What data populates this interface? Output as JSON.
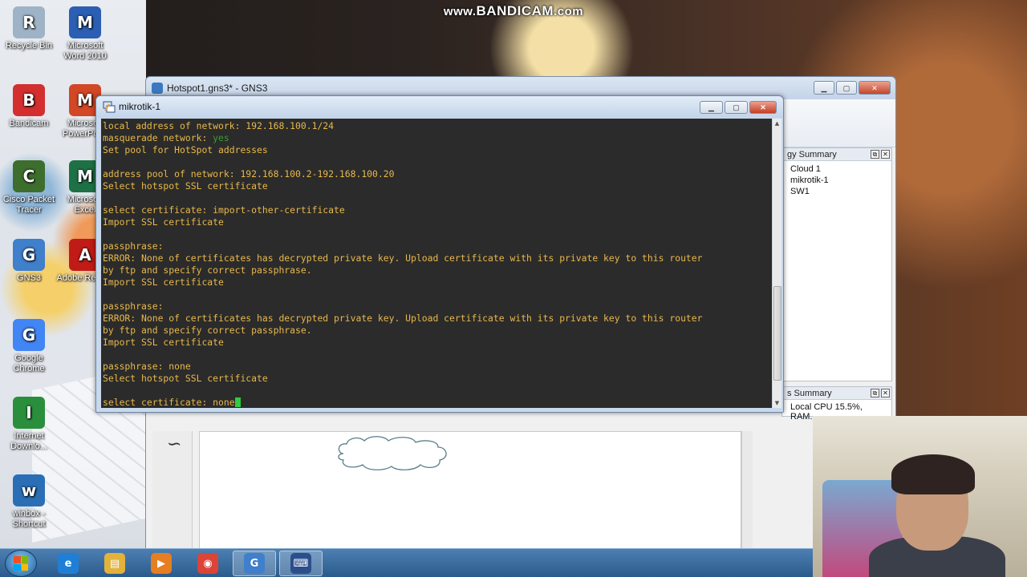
{
  "watermark": {
    "prefix": "www.",
    "brand": "BANDICAM",
    "suffix": ".com"
  },
  "desktop_icons": [
    {
      "label": "Recycle Bin",
      "icon": "recycle-bin-icon",
      "color": "#9fb3c6"
    },
    {
      "label": "Microsoft Word 2010",
      "icon": "word-icon",
      "color": "#2b5fb4"
    },
    {
      "label": "Bandicam",
      "icon": "bandicam-icon",
      "color": "#d32f2f"
    },
    {
      "label": "Microsoft PowerPoint",
      "icon": "powerpoint-icon",
      "color": "#d24726"
    },
    {
      "label": "Cisco Packet Tracer",
      "icon": "packet-tracer-icon",
      "color": "#3d6e2d"
    },
    {
      "label": "Microsoft Excel",
      "icon": "excel-icon",
      "color": "#1e7145"
    },
    {
      "label": "GNS3",
      "icon": "gns3-icon",
      "color": "#3f7fcb"
    },
    {
      "label": "Adobe Reader",
      "icon": "adobe-reader-icon",
      "color": "#c11b17"
    },
    {
      "label": "Google Chrome",
      "icon": "chrome-icon",
      "color": "#4285f4"
    },
    {
      "label": "Internet Downlo...",
      "icon": "internet-download-manager-icon",
      "color": "#2a8f3c"
    },
    {
      "label": "winbox - Shortcut",
      "icon": "winbox-icon",
      "color": "#2a6fb5"
    }
  ],
  "gns3": {
    "title": "Hotspot1.gns3* - GNS3",
    "topology_summary": {
      "title": "gy Summary",
      "items": [
        "Cloud 1",
        "mikrotik-1",
        "SW1"
      ]
    },
    "servers_summary": {
      "title": "s Summary",
      "status": "Local CPU 15.5%, RAM..."
    }
  },
  "terminal": {
    "title": "mikrotik-1",
    "lines": [
      "local address of network: 192.168.100.1/24",
      "masquerade network: ",
      "Set pool for HotSpot addresses",
      "",
      "address pool of network: 192.168.100.2-192.168.100.20",
      "Select hotspot SSL certificate",
      "",
      "select certificate: import-other-certificate",
      "Import SSL certificate",
      "",
      "passphrase:",
      "ERROR: None of certificates has decrypted private key. Upload certificate with its private key to this router",
      "by ftp and specify correct passphrase.",
      "Import SSL certificate",
      "",
      "passphrase:",
      "ERROR: None of certificates has decrypted private key. Upload certificate with its private key to this router",
      "by ftp and specify correct passphrase.",
      "Import SSL certificate",
      "",
      "passphrase: none",
      "Select hotspot SSL certificate",
      "",
      "select certificate: none"
    ],
    "masquerade_value": "yes",
    "scroll_position": 0.9
  },
  "taskbar": {
    "items": [
      {
        "name": "ie-icon",
        "color": "#1f7fd6",
        "glyph": "e"
      },
      {
        "name": "explorer-icon",
        "color": "#e2b23a",
        "glyph": "▤"
      },
      {
        "name": "media-player-icon",
        "color": "#e67e22",
        "glyph": "▶"
      },
      {
        "name": "chrome-icon",
        "color": "#db4437",
        "glyph": "◉"
      },
      {
        "name": "gns3-icon",
        "color": "#3f7fcb",
        "glyph": "G"
      },
      {
        "name": "putty-icon",
        "color": "#2b4e8c",
        "glyph": "⌨"
      }
    ]
  }
}
